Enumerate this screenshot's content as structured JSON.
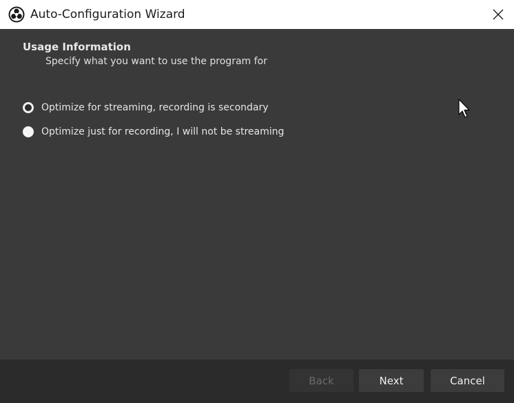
{
  "window": {
    "title": "Auto-Configuration Wizard"
  },
  "page": {
    "heading": "Usage Information",
    "subheading": "Specify what you want to use the program for"
  },
  "options": [
    {
      "label": "Optimize for streaming, recording is secondary",
      "selected": true
    },
    {
      "label": "Optimize just for recording, I will not be streaming",
      "selected": false
    }
  ],
  "buttons": {
    "back": "Back",
    "next": "Next",
    "cancel": "Cancel"
  },
  "colors": {
    "content_bg": "#3a3a3a",
    "footer_bg": "#2b2b2b",
    "titlebar_bg": "#ffffff"
  }
}
